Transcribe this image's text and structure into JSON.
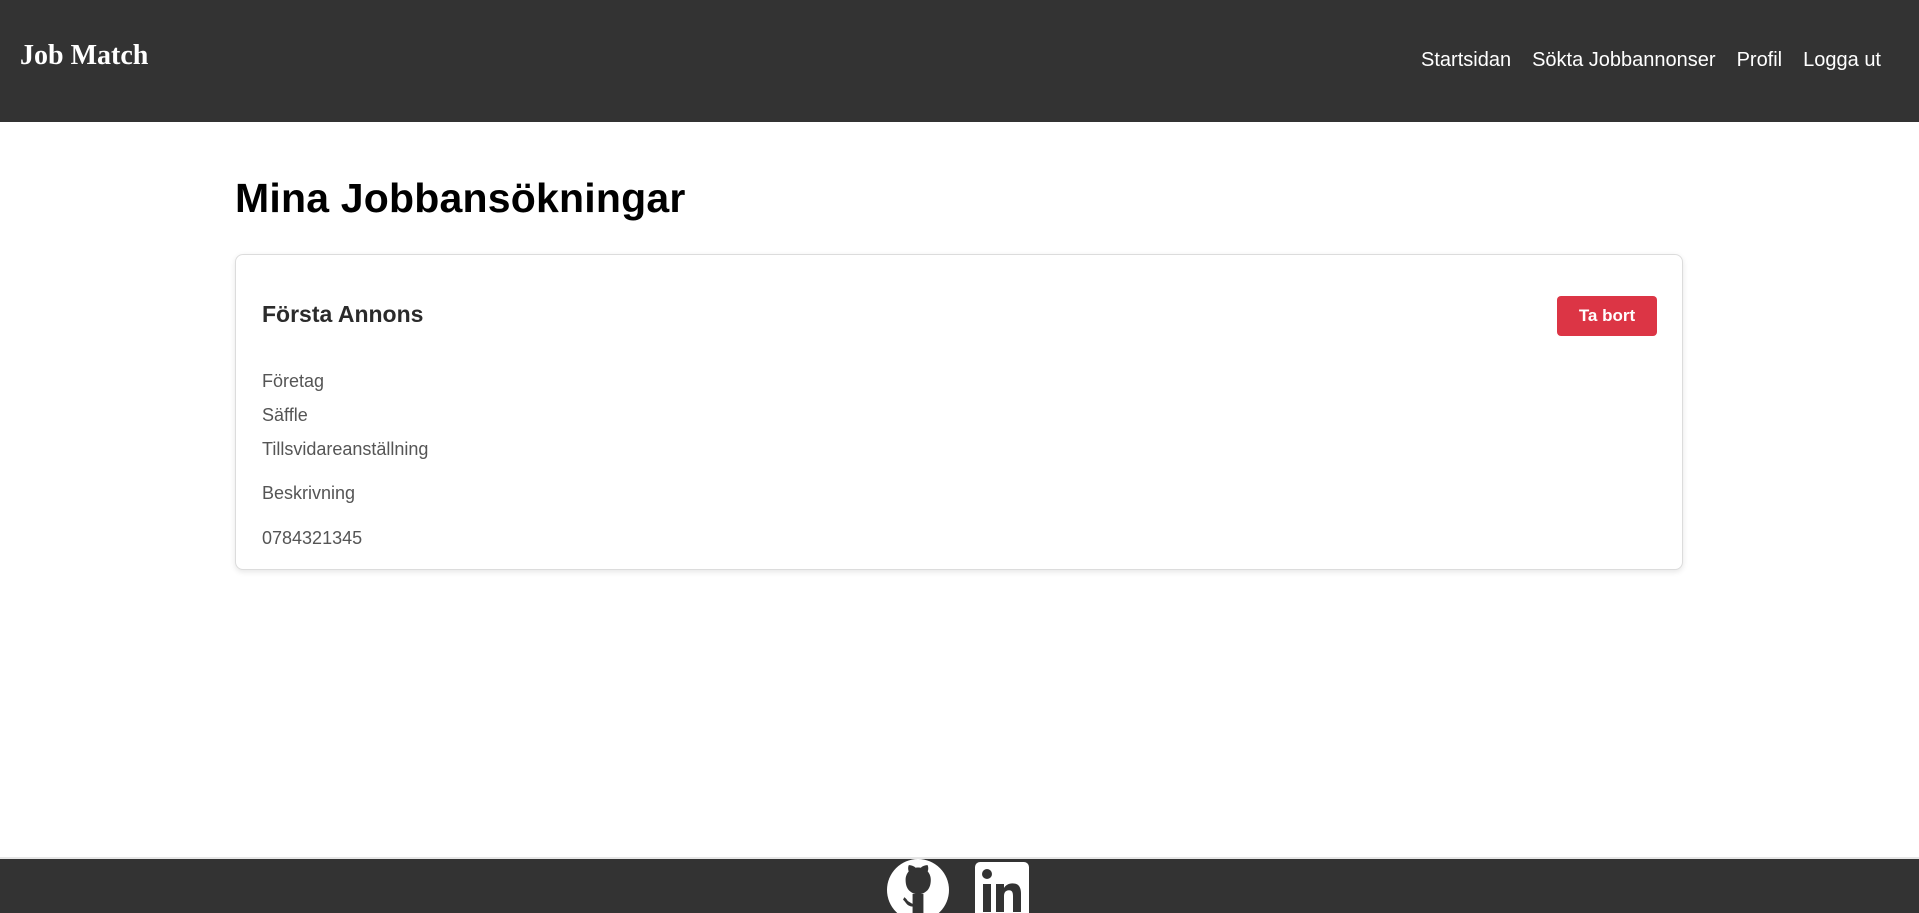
{
  "header": {
    "brand": "Job Match",
    "nav": [
      {
        "label": "Startsidan"
      },
      {
        "label": "Sökta Jobbannonser"
      },
      {
        "label": "Profil"
      },
      {
        "label": "Logga ut"
      }
    ]
  },
  "main": {
    "title": "Mina Jobbansökningar",
    "applications": [
      {
        "title": "Första Annons",
        "delete_label": "Ta bort",
        "company": "Företag",
        "city": "Säffle",
        "employment_type": "Tillsvidareanställning",
        "description": "Beskrivning",
        "phone": "0784321345"
      }
    ]
  },
  "footer": {
    "icons": [
      "github-icon",
      "linkedin-icon"
    ]
  },
  "colors": {
    "bar_background": "#333333",
    "danger": "#dc3545",
    "text_muted": "#555555"
  }
}
